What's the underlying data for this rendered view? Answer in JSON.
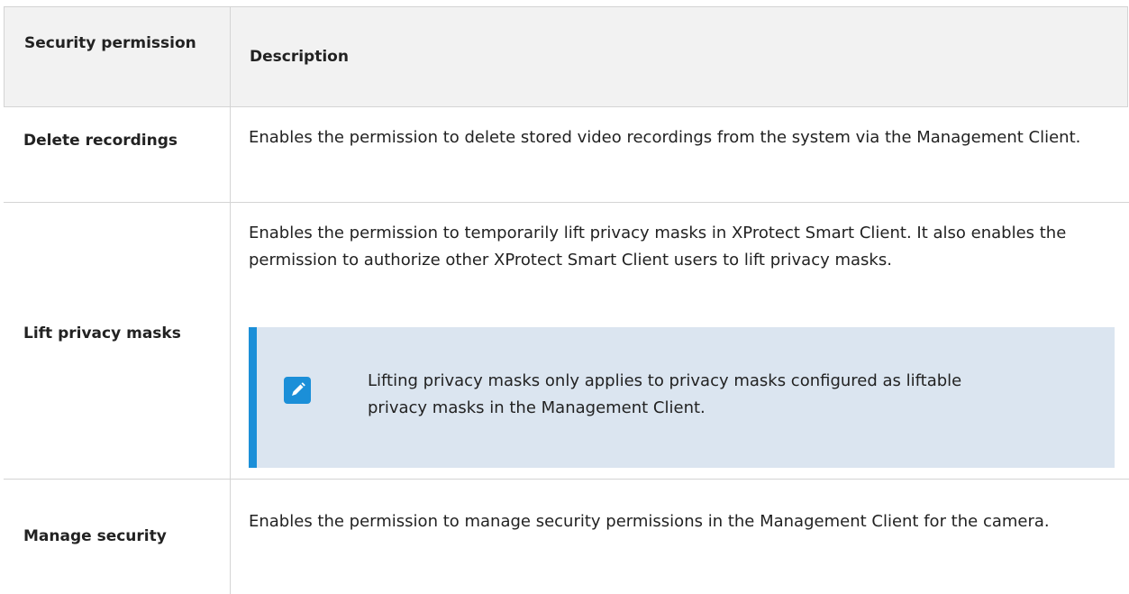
{
  "table": {
    "header": {
      "permission": "Security permission",
      "description": "Description"
    },
    "rows": [
      {
        "permission": "Delete recordings",
        "description": "Enables the permission to delete stored video recordings from the system via the Management Client."
      },
      {
        "permission": "Lift privacy masks",
        "description": "Enables the permission to temporarily lift privacy masks in XProtect Smart Client. It also enables the permission to authorize other XProtect Smart Client users to lift privacy masks.",
        "note": {
          "icon": "pencil-icon",
          "text": "Lifting privacy masks only applies to privacy masks configured as liftable privacy masks in the Management Client."
        }
      },
      {
        "permission": "Manage security",
        "description": "Enables the permission to manage security permissions in the Management Client for the camera."
      }
    ]
  },
  "colors": {
    "header_bg": "#f2f2f2",
    "note_bg": "#dbe5f0",
    "note_accent": "#1b8fd8",
    "border": "#d4d4d4"
  }
}
